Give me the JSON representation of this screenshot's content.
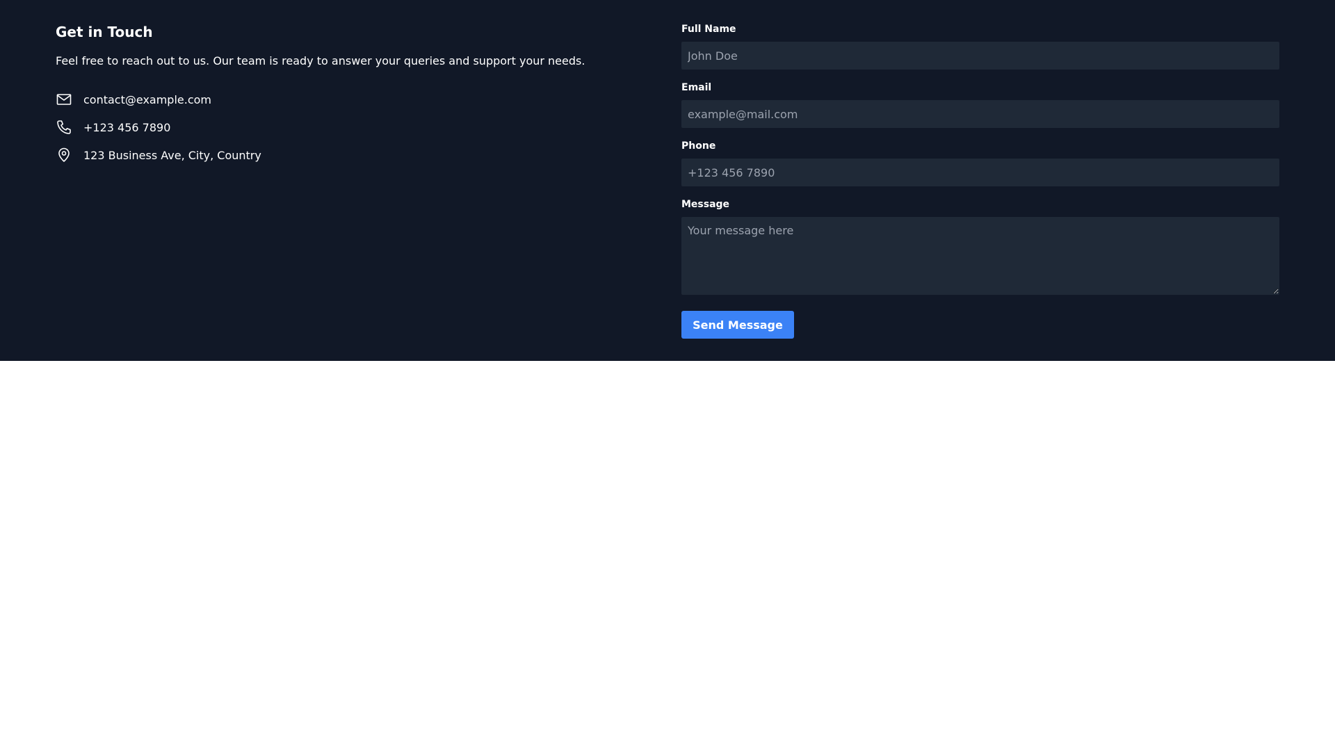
{
  "contact_section": {
    "title": "Get in Touch",
    "intro": "Feel free to reach out to us. Our team is ready to answer your queries and support your needs.",
    "items": [
      {
        "icon": "mail-icon",
        "text": "contact@example.com"
      },
      {
        "icon": "phone-icon",
        "text": "+123 456 7890"
      },
      {
        "icon": "location-pin-icon",
        "text": "123 Business Ave, City, Country"
      }
    ]
  },
  "form": {
    "full_name": {
      "label": "Full Name",
      "placeholder": "John Doe"
    },
    "email": {
      "label": "Email",
      "placeholder": "example@mail.com"
    },
    "phone": {
      "label": "Phone",
      "placeholder": "+123 456 7890"
    },
    "message": {
      "label": "Message",
      "placeholder": "Your message here"
    },
    "submit_label": "Send Message"
  },
  "colors": {
    "background": "#111827",
    "input_background": "#1f2937",
    "accent": "#3b82f6",
    "text": "#ffffff",
    "placeholder": "#9ca3af"
  }
}
